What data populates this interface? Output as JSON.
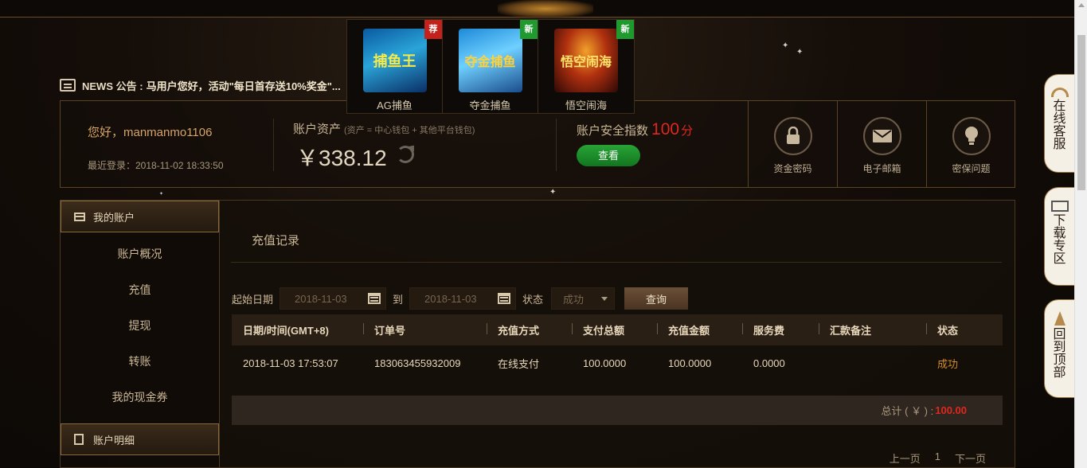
{
  "news": {
    "label": "NEWS 公告 :",
    "text": "马用户您好，活动\"每日首存送10%奖金\"..."
  },
  "games": [
    {
      "thumb": "捕鱼王",
      "name": "AG捕鱼",
      "badge": "荐",
      "badge_color": "#c4211a"
    },
    {
      "thumb": "夺金捕鱼",
      "name": "夺金捕鱼",
      "badge": "新",
      "badge_color": "#1e9a2e"
    },
    {
      "thumb": "悟空闹海",
      "name": "悟空闹海",
      "badge": "新",
      "badge_color": "#1e9a2e"
    }
  ],
  "account": {
    "greeting": "您好，manmanmo1106",
    "last_login": "最近登录：2018-11-02 18:33:50",
    "assets_title": "账户资产",
    "assets_sub": "(资产 = 中心钱包 + 其他平台钱包)",
    "assets_value": "￥338.12",
    "safety_title": "账户安全指数",
    "safety_score": "100",
    "safety_unit": "分",
    "check_label": "查看",
    "security_items": [
      "资金密码",
      "电子邮箱",
      "密保问题"
    ]
  },
  "sidebar": {
    "section1": "我的账户",
    "items": [
      "账户概况",
      "充值",
      "提现",
      "转账",
      "我的现金券"
    ],
    "section2": "账户明细"
  },
  "main": {
    "title": "充值记录",
    "start_label": "起始日期",
    "start_date": "2018-11-03",
    "to_label": "到",
    "end_date": "2018-11-03",
    "status_label": "状态",
    "status_value": "成功",
    "query_label": "查询",
    "columns": [
      "日期/时间(GMT+8)",
      "订单号",
      "充值方式",
      "支付总额",
      "充值金额",
      "服务费",
      "汇款备注",
      "状态"
    ],
    "rows": [
      [
        "2018-11-03 17:53:07",
        "183063455932009",
        "在线支付",
        "100.0000",
        "100.0000",
        "0.0000",
        "",
        "成功"
      ]
    ],
    "total_label": "总计 ( ￥ ) :",
    "total_value": "100.00",
    "pager": {
      "prev": "上一页",
      "page": "1",
      "next": "下一页"
    }
  },
  "float_tabs": [
    "在线客服",
    "下载专区",
    "回到顶部"
  ],
  "colors": {
    "accent": "#d28b2a",
    "danger": "#e0271f",
    "success": "#1e9a2e"
  }
}
